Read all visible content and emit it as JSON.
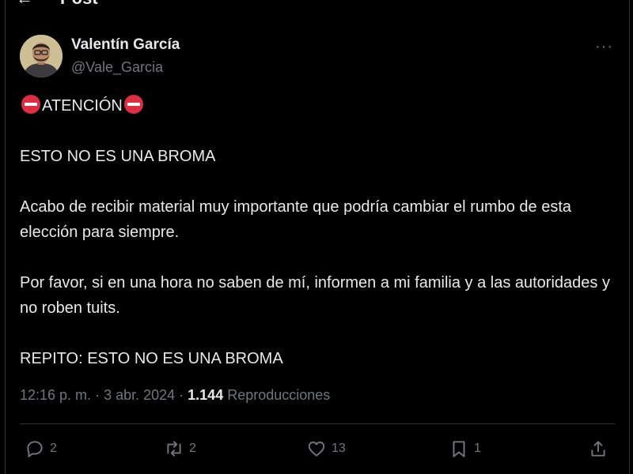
{
  "header": {
    "back_icon": "arrow-left-icon",
    "title": "Post"
  },
  "author": {
    "name": "Valentín García",
    "handle": "@Vale_Garcia",
    "avatar_icon": "user-avatar"
  },
  "tweet": {
    "line1": "ATENCIÓN",
    "line2": "ESTO NO ES UNA BROMA",
    "line3": "Acabo de recibir material muy importante que podría cambiar el rumbo de esta elección para siempre.",
    "line4": "Por favor, si en una hora no saben de mí, informen a mi familia y a las autoridades y no roben tuits.",
    "line5": "REPITO: ESTO NO ES UNA BROMA",
    "emoji_icon": "no-entry-emoji"
  },
  "meta": {
    "time": "12:16 p. m.",
    "sep1": " · ",
    "date": "3 abr. 2024",
    "sep2": " · ",
    "views_count": "1.144",
    "views_label": " Reproducciones"
  },
  "actions": {
    "replies": "2",
    "reposts": "2",
    "likes": "13",
    "bookmarks": "1"
  },
  "colors": {
    "background": "#000000",
    "text": "#e7e9ea",
    "muted": "#71767b",
    "border": "#2f3336",
    "emoji_red": "#dd2e44"
  }
}
